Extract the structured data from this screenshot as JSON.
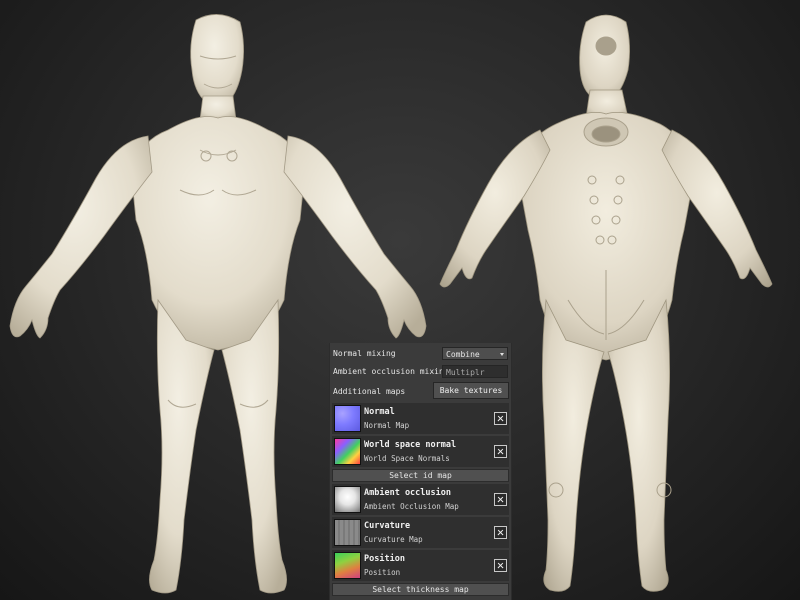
{
  "viewport": {
    "background": "#2a2a2a",
    "model_color": "#e6e1d2",
    "models": [
      {
        "view": "front"
      },
      {
        "view": "back"
      }
    ]
  },
  "panel": {
    "normal_mixing": {
      "label": "Normal mixing",
      "value": "Combine"
    },
    "ao_mixing": {
      "label": "Ambient occlusion mixing",
      "value": "Multiplr"
    },
    "additional_maps": {
      "label": "Additional maps",
      "button": "Bake textures"
    },
    "maps": [
      {
        "title": "Normal",
        "subtitle": "Normal Map",
        "icon": "normal-map-thumbnail"
      },
      {
        "title": "World space normal",
        "subtitle": "World Space Normals",
        "icon": "world-space-normal-thumbnail"
      },
      {
        "title": "Ambient occlusion",
        "subtitle": "Ambient Occlusion Map",
        "icon": "ambient-occlusion-thumbnail"
      },
      {
        "title": "Curvature",
        "subtitle": "Curvature Map",
        "icon": "curvature-thumbnail"
      },
      {
        "title": "Position",
        "subtitle": "Position",
        "icon": "position-thumbnail"
      }
    ],
    "select_id_map": "Select id map",
    "select_thickness_map": "Select thickness map"
  }
}
